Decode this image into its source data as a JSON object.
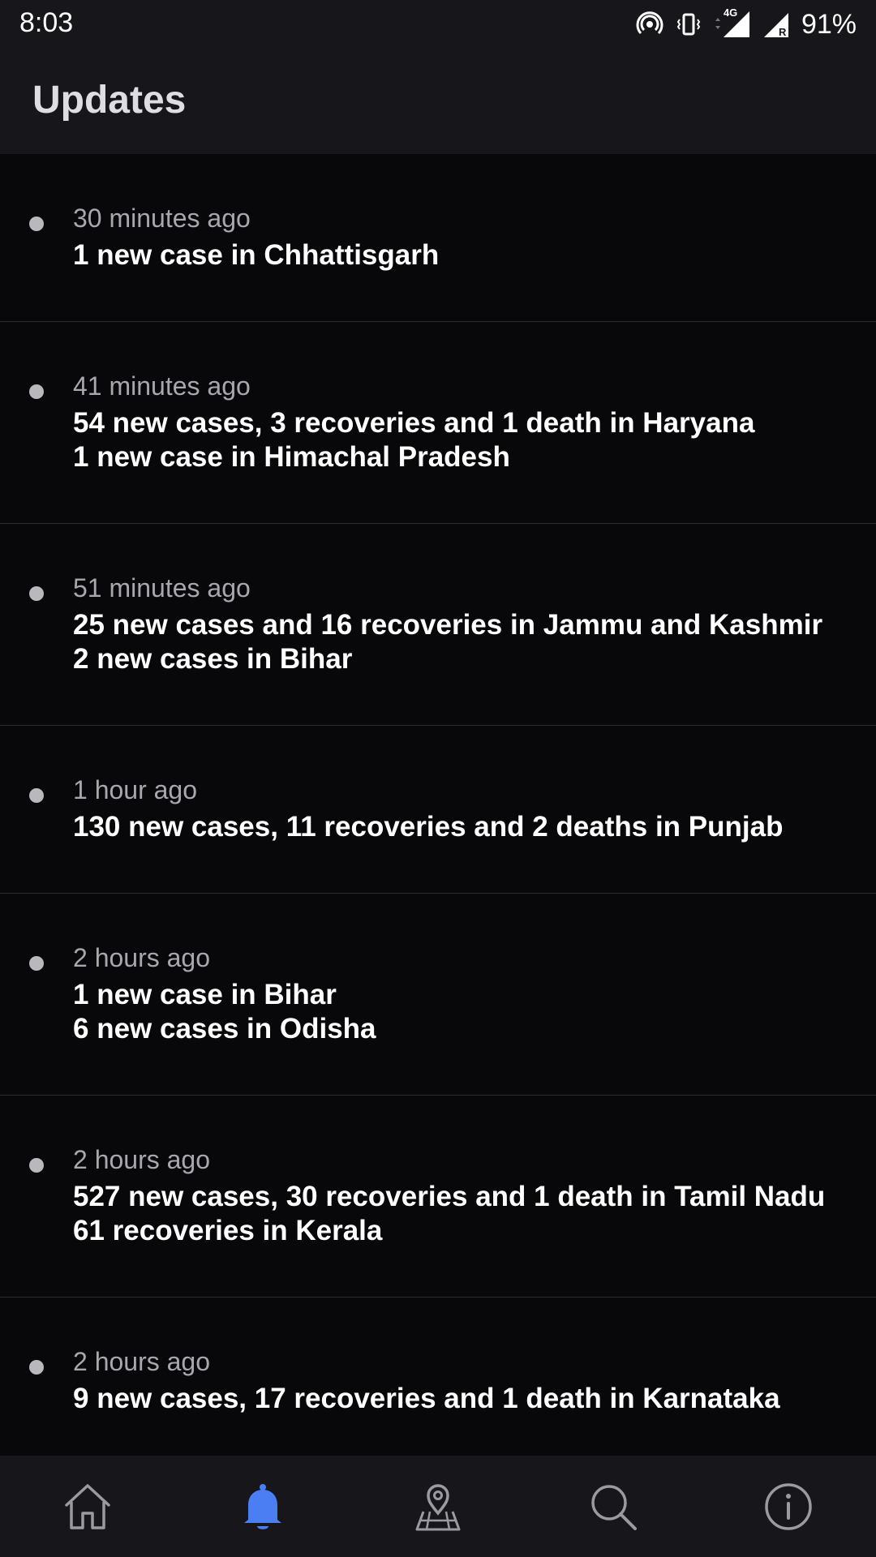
{
  "status_bar": {
    "time": "8:03",
    "network_label": "4G",
    "roaming_label": "R",
    "battery": "91%"
  },
  "header": {
    "title": "Updates"
  },
  "updates": [
    {
      "time": "30 minutes ago",
      "lines": [
        "1 new case in Chhattisgarh"
      ]
    },
    {
      "time": "41 minutes ago",
      "lines": [
        "54 new cases, 3 recoveries and 1 death in Haryana",
        "1 new case in Himachal Pradesh"
      ]
    },
    {
      "time": "51 minutes ago",
      "lines": [
        "25 new cases and 16 recoveries in Jammu and Kashmir",
        "2 new cases in Bihar"
      ]
    },
    {
      "time": "1 hour ago",
      "lines": [
        "130 new cases, 11 recoveries and 2 deaths in Punjab"
      ]
    },
    {
      "time": "2 hours ago",
      "lines": [
        "1 new case in Bihar",
        "6 new cases in Odisha"
      ]
    },
    {
      "time": "2 hours ago",
      "lines": [
        "527 new cases, 30 recoveries and 1 death in Tamil Nadu",
        "61 recoveries in Kerala"
      ]
    },
    {
      "time": "2 hours ago",
      "lines": [
        "9 new cases, 17 recoveries and 1 death in Karnataka"
      ]
    }
  ],
  "bottom_nav": {
    "items": [
      {
        "icon": "home-icon",
        "active": false
      },
      {
        "icon": "bell-icon",
        "active": true
      },
      {
        "icon": "map-pin-icon",
        "active": false
      },
      {
        "icon": "search-icon",
        "active": false
      },
      {
        "icon": "info-icon",
        "active": false
      }
    ]
  },
  "colors": {
    "background": "#08080b",
    "bar_background": "#16161b",
    "accent": "#4c7ef3",
    "icon_inactive": "#9a9aa0",
    "secondary_text": "#a7a7ad"
  }
}
